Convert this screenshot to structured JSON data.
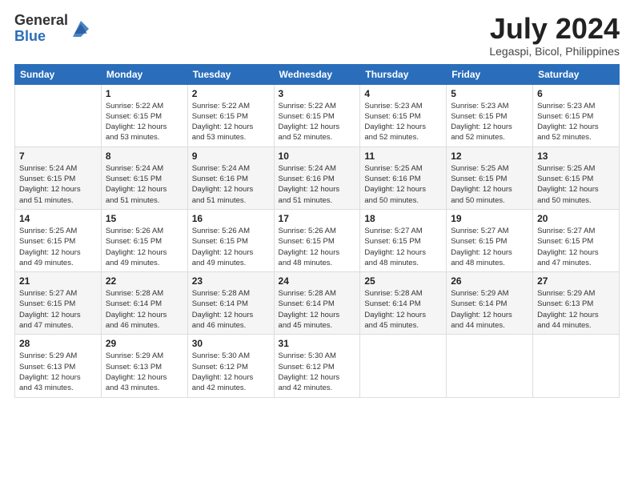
{
  "logo": {
    "general": "General",
    "blue": "Blue"
  },
  "title": "July 2024",
  "subtitle": "Legaspi, Bicol, Philippines",
  "days_of_week": [
    "Sunday",
    "Monday",
    "Tuesday",
    "Wednesday",
    "Thursday",
    "Friday",
    "Saturday"
  ],
  "weeks": [
    [
      {
        "day": "",
        "info": ""
      },
      {
        "day": "1",
        "info": "Sunrise: 5:22 AM\nSunset: 6:15 PM\nDaylight: 12 hours\nand 53 minutes."
      },
      {
        "day": "2",
        "info": "Sunrise: 5:22 AM\nSunset: 6:15 PM\nDaylight: 12 hours\nand 53 minutes."
      },
      {
        "day": "3",
        "info": "Sunrise: 5:22 AM\nSunset: 6:15 PM\nDaylight: 12 hours\nand 52 minutes."
      },
      {
        "day": "4",
        "info": "Sunrise: 5:23 AM\nSunset: 6:15 PM\nDaylight: 12 hours\nand 52 minutes."
      },
      {
        "day": "5",
        "info": "Sunrise: 5:23 AM\nSunset: 6:15 PM\nDaylight: 12 hours\nand 52 minutes."
      },
      {
        "day": "6",
        "info": "Sunrise: 5:23 AM\nSunset: 6:15 PM\nDaylight: 12 hours\nand 52 minutes."
      }
    ],
    [
      {
        "day": "7",
        "info": "Sunrise: 5:24 AM\nSunset: 6:15 PM\nDaylight: 12 hours\nand 51 minutes."
      },
      {
        "day": "8",
        "info": "Sunrise: 5:24 AM\nSunset: 6:15 PM\nDaylight: 12 hours\nand 51 minutes."
      },
      {
        "day": "9",
        "info": "Sunrise: 5:24 AM\nSunset: 6:16 PM\nDaylight: 12 hours\nand 51 minutes."
      },
      {
        "day": "10",
        "info": "Sunrise: 5:24 AM\nSunset: 6:16 PM\nDaylight: 12 hours\nand 51 minutes."
      },
      {
        "day": "11",
        "info": "Sunrise: 5:25 AM\nSunset: 6:16 PM\nDaylight: 12 hours\nand 50 minutes."
      },
      {
        "day": "12",
        "info": "Sunrise: 5:25 AM\nSunset: 6:15 PM\nDaylight: 12 hours\nand 50 minutes."
      },
      {
        "day": "13",
        "info": "Sunrise: 5:25 AM\nSunset: 6:15 PM\nDaylight: 12 hours\nand 50 minutes."
      }
    ],
    [
      {
        "day": "14",
        "info": "Sunrise: 5:25 AM\nSunset: 6:15 PM\nDaylight: 12 hours\nand 49 minutes."
      },
      {
        "day": "15",
        "info": "Sunrise: 5:26 AM\nSunset: 6:15 PM\nDaylight: 12 hours\nand 49 minutes."
      },
      {
        "day": "16",
        "info": "Sunrise: 5:26 AM\nSunset: 6:15 PM\nDaylight: 12 hours\nand 49 minutes."
      },
      {
        "day": "17",
        "info": "Sunrise: 5:26 AM\nSunset: 6:15 PM\nDaylight: 12 hours\nand 48 minutes."
      },
      {
        "day": "18",
        "info": "Sunrise: 5:27 AM\nSunset: 6:15 PM\nDaylight: 12 hours\nand 48 minutes."
      },
      {
        "day": "19",
        "info": "Sunrise: 5:27 AM\nSunset: 6:15 PM\nDaylight: 12 hours\nand 48 minutes."
      },
      {
        "day": "20",
        "info": "Sunrise: 5:27 AM\nSunset: 6:15 PM\nDaylight: 12 hours\nand 47 minutes."
      }
    ],
    [
      {
        "day": "21",
        "info": "Sunrise: 5:27 AM\nSunset: 6:15 PM\nDaylight: 12 hours\nand 47 minutes."
      },
      {
        "day": "22",
        "info": "Sunrise: 5:28 AM\nSunset: 6:14 PM\nDaylight: 12 hours\nand 46 minutes."
      },
      {
        "day": "23",
        "info": "Sunrise: 5:28 AM\nSunset: 6:14 PM\nDaylight: 12 hours\nand 46 minutes."
      },
      {
        "day": "24",
        "info": "Sunrise: 5:28 AM\nSunset: 6:14 PM\nDaylight: 12 hours\nand 45 minutes."
      },
      {
        "day": "25",
        "info": "Sunrise: 5:28 AM\nSunset: 6:14 PM\nDaylight: 12 hours\nand 45 minutes."
      },
      {
        "day": "26",
        "info": "Sunrise: 5:29 AM\nSunset: 6:14 PM\nDaylight: 12 hours\nand 44 minutes."
      },
      {
        "day": "27",
        "info": "Sunrise: 5:29 AM\nSunset: 6:13 PM\nDaylight: 12 hours\nand 44 minutes."
      }
    ],
    [
      {
        "day": "28",
        "info": "Sunrise: 5:29 AM\nSunset: 6:13 PM\nDaylight: 12 hours\nand 43 minutes."
      },
      {
        "day": "29",
        "info": "Sunrise: 5:29 AM\nSunset: 6:13 PM\nDaylight: 12 hours\nand 43 minutes."
      },
      {
        "day": "30",
        "info": "Sunrise: 5:30 AM\nSunset: 6:12 PM\nDaylight: 12 hours\nand 42 minutes."
      },
      {
        "day": "31",
        "info": "Sunrise: 5:30 AM\nSunset: 6:12 PM\nDaylight: 12 hours\nand 42 minutes."
      },
      {
        "day": "",
        "info": ""
      },
      {
        "day": "",
        "info": ""
      },
      {
        "day": "",
        "info": ""
      }
    ]
  ]
}
